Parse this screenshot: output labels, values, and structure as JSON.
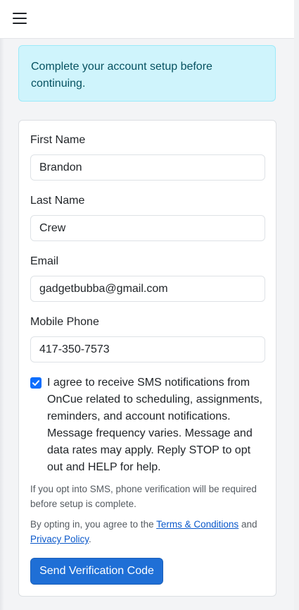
{
  "alert": {
    "text": "Complete your account setup before continuing."
  },
  "form": {
    "first_name": {
      "label": "First Name",
      "value": "Brandon"
    },
    "last_name": {
      "label": "Last Name",
      "value": "Crew"
    },
    "email": {
      "label": "Email",
      "value": "gadgetbubba@gmail.com"
    },
    "mobile_phone": {
      "label": "Mobile Phone",
      "value": "417-350-7573"
    },
    "sms_consent": {
      "checked": true,
      "text": "I agree to receive SMS notifications from OnCue related to scheduling, assignments, reminders, and account notifications. Message frequency varies. Message and data rates may apply. Reply STOP to opt out and HELP for help."
    },
    "verification_note": "If you opt into SMS, phone verification will be required before setup is complete.",
    "terms_note": {
      "prefix": "By opting in, you agree to the ",
      "terms_link": "Terms & Conditions",
      "middle": " and ",
      "privacy_link": "Privacy Policy",
      "suffix": "."
    },
    "submit_label": "Send Verification Code"
  },
  "colors": {
    "accent": "#1f6fd6",
    "alert_bg": "#cff4fc",
    "alert_text": "#055160"
  }
}
